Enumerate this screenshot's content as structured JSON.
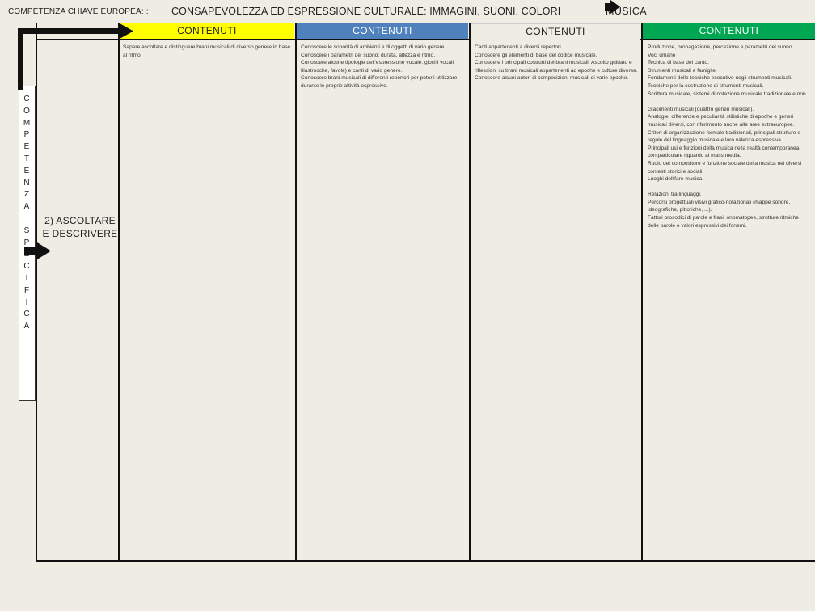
{
  "header": {
    "prefix": "COMPETENZA CHIAVE EUROPEA:  :",
    "title": "CONSAPEVOLEZZA ED ESPRESSIONE CULTURALE:  IMMAGINI, SUONI, COLORI",
    "subject": "MUSICA"
  },
  "columns": [
    {
      "label": "CONTENUTI",
      "color": "#ffff00"
    },
    {
      "label": "CONTENUTI",
      "color": "#4f81bd"
    },
    {
      "label": "CONTENUTI",
      "color": "#efece3"
    },
    {
      "label": "CONTENUTI",
      "color": "#00a651"
    }
  ],
  "vertical_label": "C\nO\nM\nP\nE\nT\nE\nN\nZ\nA\n\nS\nP\nE\nC\nI\nF\nI\nC\nA",
  "section_label": "2) ASCOLTARE E DESCRIVERE",
  "cells": [
    "Sapere ascoltare e distinguere brani musicali di diverso genere in base al ritmo.",
    "Conoscere le sonorità di ambienti e di oggetti di vario genere.\nConoscere i parametri del suono: durata, altezza e ritmo.\nConoscere alcune tipologie dell'espressione vocale: giochi vocali, filastrocche, favole) e canti di vario genere.\nConoscere brani musicali di differenti repertori per poterli utilizzare durante le proprie attività espressive.",
    "Canti appartenenti a diversi repertori.\nConoscere gli elementi di base del codice musicale.\nConoscere i principali costrutti dei brani musicali. Ascolto guidato e riflessioni su brani musicali appartenenti ad epoche e culture diverse. Conoscere alcuni autori di composizioni musicali di varie epoche.",
    "Produzione, propagazione, percezione e parametri del suono.\nVoci umane\nTecnica di base del canto.\nStrumenti musicali e famiglie.\nFondamenti delle tecniche esecutive negli strumenti musicali.\nTecniche per la costruzione di strumenti musicali.\nScrittura musicale, sistemi di notazione musicale tradizionale e non.\n\nGiacimenti musicali (quattro generi musicali).\nAnalogie, differenze e peculiarità stilistiche di epoche e generi musicali diversi, con riferimento anche alle aree extraeuropee.\nCriteri di organizzazione formale tradizionali, principali strutture e regole del linguaggio musicale e loro valenza espressiva.\nPrincipali usi e funzioni della musica nella realtà contemporanea, con particolare riguardo ai mass media.\nRuolo del compositore e funzione sociale della musica nei diversi contesti storici e sociali.\nLuoghi dell'fare musica.\n\nRelazioni tra linguaggi.\nPercorsi progettuali visivi grafico-notazionali (mappe sonore, ideografiche, pittoriche, ...).\nFattori prosodici di parole e frasi, onomatopee, strutture ritmiche delle parole e valori espressivi dei fonemi."
  ],
  "colors": {
    "background": "#efece3",
    "yellow": "#ffff00",
    "blue": "#4f81bd",
    "green": "#00a651",
    "lines": "#111111"
  },
  "icons": [
    "arrow-right-icon",
    "arrow-right-icon",
    "arrow-right-icon"
  ]
}
